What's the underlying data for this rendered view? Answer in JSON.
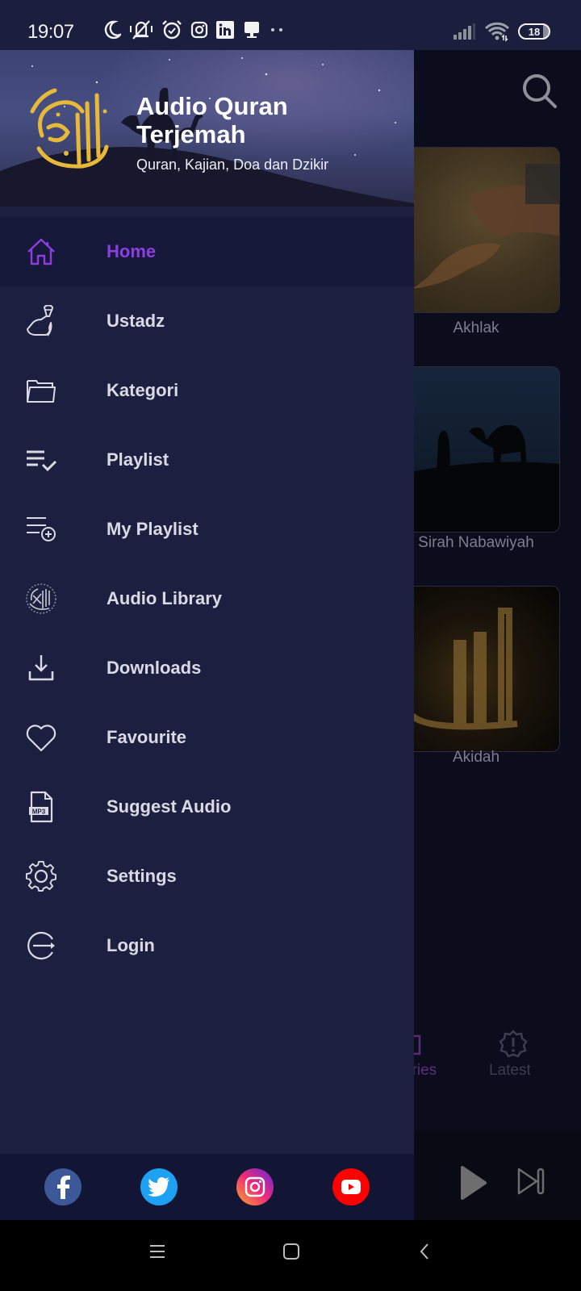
{
  "status_bar": {
    "time": "19:07",
    "left_icons": [
      "moon-icon",
      "vibrate-off-icon",
      "alarm-icon",
      "instagram-notification-icon",
      "linkedin-notification-icon",
      "notification-bell-icon",
      "more-dots-icon"
    ],
    "right_icons": [
      "signal-icon",
      "wifi-icon",
      "battery-icon"
    ],
    "battery_level": "18"
  },
  "drawer": {
    "header": {
      "title": "Audio Quran Terjemah",
      "title_line1": "Audio Quran",
      "title_line2": "Terjemah",
      "subtitle": "Quran, Kajian, Doa dan Dzikir",
      "logo": "al-quran-calligraphy-logo"
    },
    "accent_color": "#8e3ee0",
    "items": [
      {
        "label": "Home",
        "icon": "home-icon",
        "active": true
      },
      {
        "label": "Ustadz",
        "icon": "ustadz-microphone-icon",
        "active": false
      },
      {
        "label": "Kategori",
        "icon": "folder-icon",
        "active": false
      },
      {
        "label": "Playlist",
        "icon": "playlist-check-icon",
        "active": false
      },
      {
        "label": "My Playlist",
        "icon": "playlist-add-icon",
        "active": false
      },
      {
        "label": "Audio Library",
        "icon": "quran-calligraphy-icon",
        "active": false
      },
      {
        "label": "Downloads",
        "icon": "download-icon",
        "active": false
      },
      {
        "label": "Favourite",
        "icon": "heart-icon",
        "active": false
      },
      {
        "label": "Suggest Audio",
        "icon": "mp3-file-icon",
        "active": false
      },
      {
        "label": "Settings",
        "icon": "gear-icon",
        "active": false
      },
      {
        "label": "Login",
        "icon": "login-icon",
        "active": false
      }
    ],
    "social": [
      {
        "name": "facebook",
        "color": "#3b5998"
      },
      {
        "name": "twitter",
        "color": "#1da1f2"
      },
      {
        "name": "instagram",
        "color": "#d6249f"
      },
      {
        "name": "youtube",
        "color": "#ff0000"
      }
    ]
  },
  "background_app": {
    "categories": [
      {
        "label": "Akhlak"
      },
      {
        "label": "Sirah Nabawiyah"
      },
      {
        "label": "Akidah"
      }
    ],
    "tabs": [
      {
        "label": "ories",
        "active": true
      },
      {
        "label": "Latest",
        "active": false
      }
    ]
  },
  "nav_bar": {
    "buttons": [
      "recents-button",
      "home-button",
      "back-button"
    ]
  }
}
